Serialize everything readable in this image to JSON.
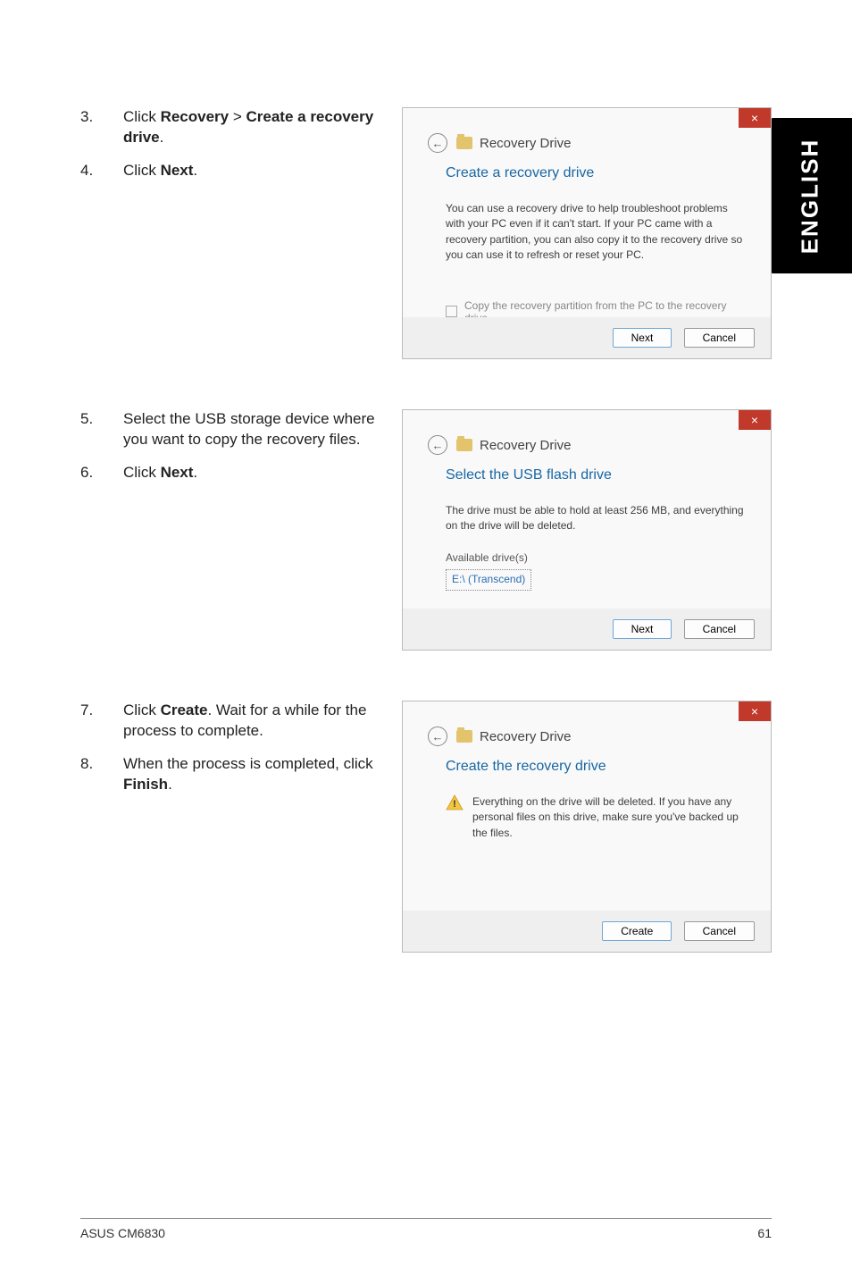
{
  "sideTab": "ENGLISH",
  "steps": {
    "s3": {
      "num": "3.",
      "pre": "Click ",
      "b1": "Recovery",
      "mid": " > ",
      "b2": "Create a recovery drive",
      "post": "."
    },
    "s4": {
      "num": "4.",
      "pre": "Click ",
      "b1": "Next",
      "post": "."
    },
    "s5": {
      "num": "5.",
      "txt": "Select the USB storage device where you want to copy the recovery files."
    },
    "s6": {
      "num": "6.",
      "pre": "Click ",
      "b1": "Next",
      "post": "."
    },
    "s7": {
      "num": "7.",
      "pre": "Click ",
      "b1": "Create",
      "post": ". Wait for a while for the process to complete."
    },
    "s8": {
      "num": "8.",
      "pre": "When the process is completed, click ",
      "b1": "Finish",
      "post": "."
    }
  },
  "shot1": {
    "backLabel": "Recovery Drive",
    "title": "Create a recovery drive",
    "body": "You can use a recovery drive to help troubleshoot problems with your PC even if it can't start. If your PC came with a recovery partition, you can also copy it to the recovery drive so you can use it to refresh or reset your PC.",
    "checkbox": "Copy the recovery partition from the PC to the recovery drive.",
    "btnNext": "Next",
    "btnCancel": "Cancel"
  },
  "shot2": {
    "backLabel": "Recovery Drive",
    "title": "Select the USB flash drive",
    "body": "The drive must be able to hold at least 256 MB, and everything on the drive will be deleted.",
    "availLabel": "Available drive(s)",
    "drive": "E:\\ (Transcend)",
    "btnNext": "Next",
    "btnCancel": "Cancel"
  },
  "shot3": {
    "backLabel": "Recovery Drive",
    "title": "Create the recovery drive",
    "warn": "Everything on the drive will be deleted. If you have any personal files on this drive, make sure you've backed up the files.",
    "btnCreate": "Create",
    "btnCancel": "Cancel"
  },
  "footer": {
    "left": "ASUS CM6830",
    "right": "61"
  },
  "icons": {
    "closeX": "×",
    "backArrow": "←"
  }
}
